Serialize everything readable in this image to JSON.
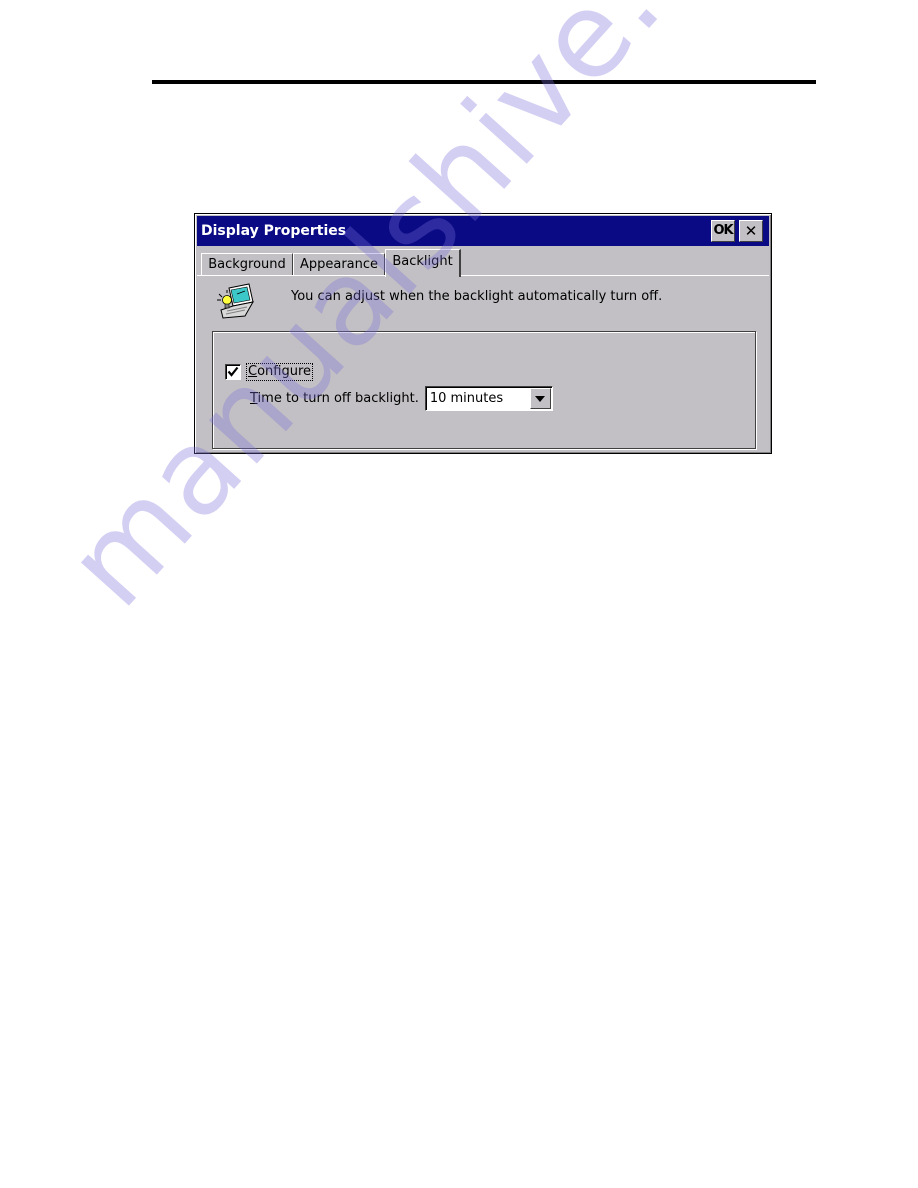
{
  "dialog": {
    "title": "Display Properties",
    "ok_button": "OK",
    "close_button": "✕",
    "tabs": [
      {
        "label": "Background",
        "active": false
      },
      {
        "label": "Appearance",
        "active": false
      },
      {
        "label": "Backlight",
        "active": true
      }
    ],
    "info_icon": "laptop-backlight-icon",
    "info_text": "You can adjust when the backlight automatically turn off.",
    "configure": {
      "label_accel": "C",
      "label_rest": "onfigure",
      "checked": true
    },
    "time_label": {
      "accel": "T",
      "rest": "ime to turn off backlight."
    },
    "time_select": {
      "value": "10 minutes"
    },
    "colors": {
      "titlebar": "#0a0a84",
      "face": "#c2c0c4"
    }
  },
  "watermark": "manualshive.com"
}
